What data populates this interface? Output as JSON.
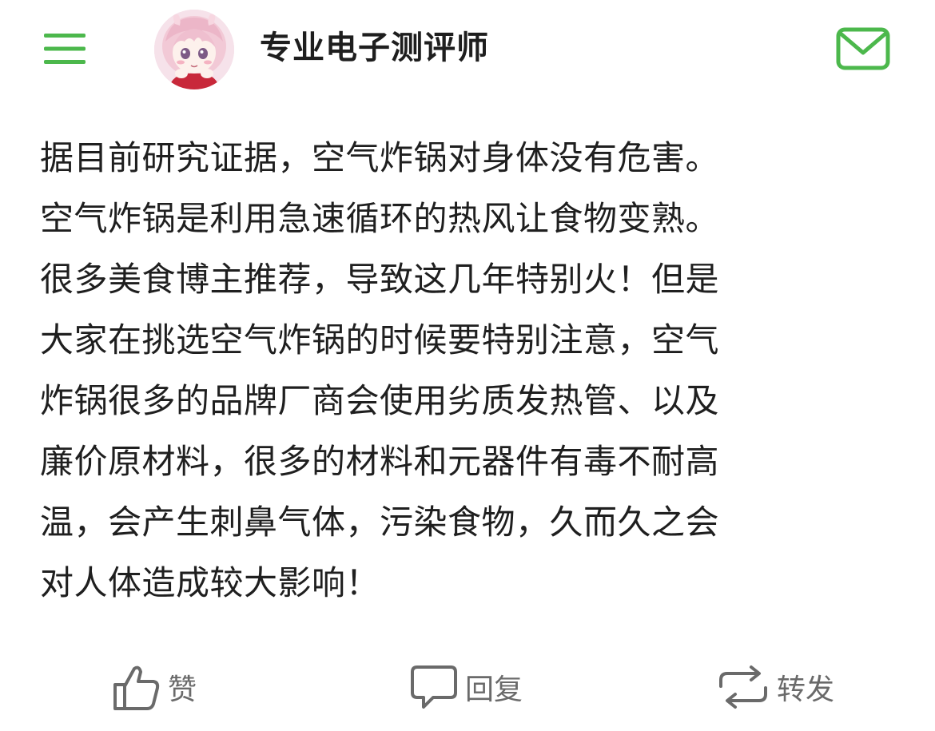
{
  "header": {
    "menu_icon": "menu-icon",
    "username": "专业电子测评师",
    "mail_icon": "mail-icon",
    "accent_color": "#4cb84c"
  },
  "post": {
    "lines": [
      "据目前研究证据，空气炸锅对身体没有危害。",
      "空气炸锅是利用急速循环的热风让食物变熟。",
      "很多美食博主推荐，导致这几年特别火！但是",
      "大家在挑选空气炸锅的时候要特别注意，空气",
      "炸锅很多的品牌厂商会使用劣质发热管、以及",
      "廉价原材料，很多的材料和元器件有毒不耐高",
      "温，会产生刺鼻气体，污染食物，久而久之会",
      "对人体造成较大影响！"
    ]
  },
  "actions": {
    "like": {
      "icon": "thumbs-up-icon",
      "label": "赞"
    },
    "reply": {
      "icon": "comment-icon",
      "label": "回复"
    },
    "share": {
      "icon": "repost-icon",
      "label": "转发"
    },
    "icon_color": "#6a6a6a"
  }
}
